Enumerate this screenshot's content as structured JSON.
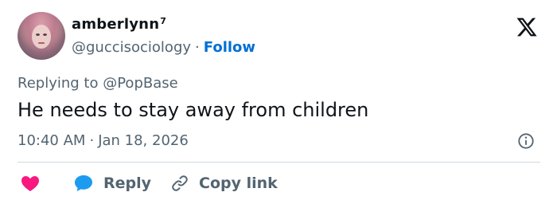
{
  "author": {
    "display_name": "amberlynn",
    "display_name_suffix": "7",
    "handle": "@guccisociology",
    "separator": "·",
    "follow_label": "Follow"
  },
  "reply_context": {
    "prefix": "Replying to",
    "mention": "@PopBase"
  },
  "tweet": {
    "text": "He needs to stay away from children"
  },
  "meta": {
    "time": "10:40 AM",
    "separator": "·",
    "date": "Jan 18, 2026"
  },
  "actions": {
    "reply_label": "Reply",
    "copy_link_label": "Copy link"
  },
  "icons": {
    "brand": "x-logo-icon",
    "info": "info-icon",
    "like": "heart-icon",
    "reply": "speech-bubble-icon",
    "copy": "link-icon"
  },
  "colors": {
    "text_primary": "#0f1419",
    "text_secondary": "#536471",
    "link_blue": "#006fd6",
    "heart_pink": "#f91880",
    "reply_blue": "#1d9bf0",
    "divider": "#cfd9de"
  }
}
